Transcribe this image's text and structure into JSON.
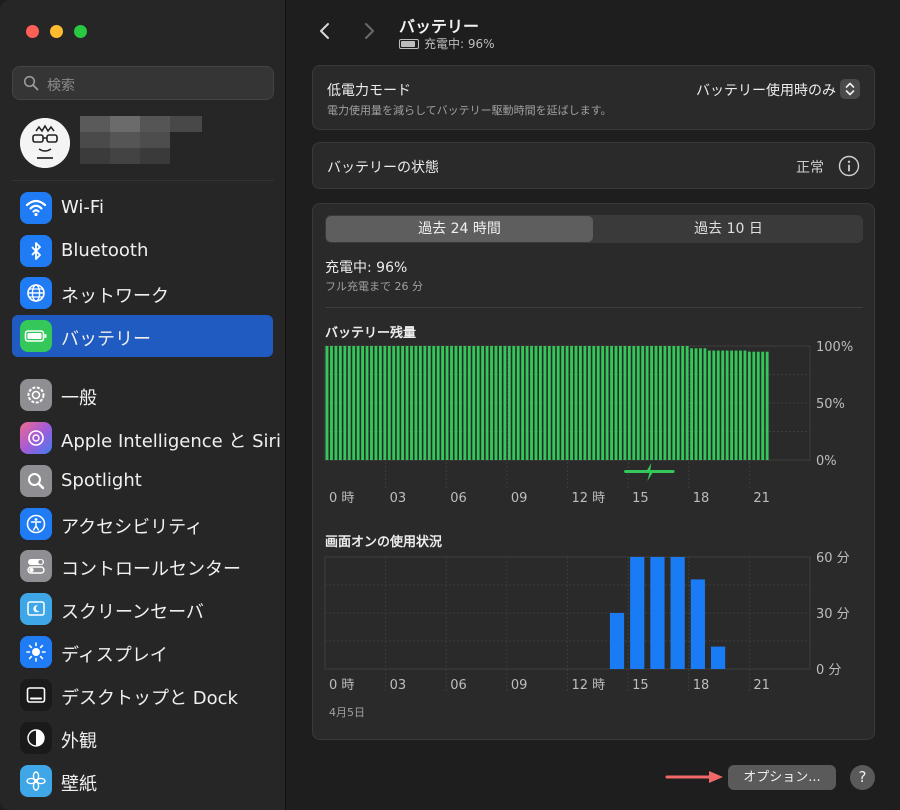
{
  "sidebar": {
    "search_placeholder": "検索",
    "items": [
      {
        "label": "Wi-Fi",
        "icon": "wifi-icon",
        "color": "#1f7cf5"
      },
      {
        "label": "Bluetooth",
        "icon": "bluetooth-icon",
        "color": "#1f7cf5"
      },
      {
        "label": "ネットワーク",
        "icon": "globe-icon",
        "color": "#1f7cf5"
      },
      {
        "label": "バッテリー",
        "icon": "battery-icon",
        "color": "#34c759",
        "active": true
      },
      {
        "label": "一般",
        "icon": "gear-icon",
        "color": "#8e8e93"
      },
      {
        "label": "Apple Intelligence と Siri",
        "icon": "siri-icon",
        "color": "#a55bd6"
      },
      {
        "label": "Spotlight",
        "icon": "magnifier-icon",
        "color": "#8e8e93"
      },
      {
        "label": "アクセシビリティ",
        "icon": "accessibility-icon",
        "color": "#1f7cf5"
      },
      {
        "label": "コントロールセンター",
        "icon": "toggles-icon",
        "color": "#8e8e93"
      },
      {
        "label": "スクリーンセーバ",
        "icon": "screensaver-icon",
        "color": "#3fa6e8"
      },
      {
        "label": "ディスプレイ",
        "icon": "sun-icon",
        "color": "#1f7cf5"
      },
      {
        "label": "デスクトップと Dock",
        "icon": "dock-icon",
        "color": "#2b2b2b"
      },
      {
        "label": "外観",
        "icon": "appearance-icon",
        "color": "#2b2b2b"
      },
      {
        "label": "壁紙",
        "icon": "flower-icon",
        "color": "#3fa6e8"
      }
    ]
  },
  "header": {
    "title": "バッテリー",
    "subtitle": "充電中: 96%"
  },
  "low_power": {
    "title": "低電力モード",
    "description": "電力使用量を減らしてバッテリー駆動時間を延ばします。",
    "value": "バッテリー使用時のみ"
  },
  "health": {
    "title": "バッテリーの状態",
    "value": "正常"
  },
  "usage": {
    "tabs": [
      "過去 24 時間",
      "過去 10 日"
    ],
    "selected_tab": 0,
    "charge_status": "充電中: 96%",
    "charge_sub": "フル充電まで 26 分",
    "date": "4月5日"
  },
  "chart_data": [
    {
      "type": "bar",
      "title": "バッテリー残量",
      "x_ticks": [
        "0 時",
        "03",
        "06",
        "09",
        "12 時",
        "15",
        "18",
        "21"
      ],
      "y_ticks": [
        "100%",
        "50%",
        "0%"
      ],
      "ylim": [
        0,
        100
      ],
      "unit": "%",
      "charging_period_hours": [
        14.8,
        17.3
      ],
      "series": [
        {
          "values_by_hour": [
            100,
            100,
            100,
            100,
            100,
            100,
            100,
            100,
            100,
            100,
            100,
            100,
            100,
            100,
            100,
            100,
            100,
            100,
            98,
            96,
            96,
            95
          ]
        }
      ],
      "color": "#34c759"
    },
    {
      "type": "bar",
      "title": "画面オンの使用状況",
      "x_ticks": [
        "0 時",
        "03",
        "06",
        "09",
        "12 時",
        "15",
        "18",
        "21"
      ],
      "y_ticks": [
        "60 分",
        "30 分",
        "0 分"
      ],
      "ylim": [
        0,
        60
      ],
      "unit": "分",
      "categories": [
        14,
        15,
        16,
        17,
        18,
        19
      ],
      "values": [
        30,
        60,
        60,
        60,
        48,
        12
      ],
      "color": "#1a7cf5"
    }
  ],
  "footer": {
    "options_label": "オプション...",
    "help_label": "?"
  }
}
